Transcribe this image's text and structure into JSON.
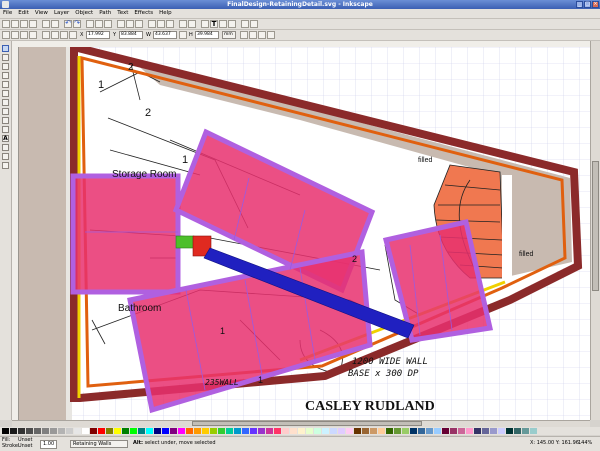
{
  "window": {
    "title": "FinalDesign-RetainingDetail.svg - Inkscape"
  },
  "menu": [
    "File",
    "Edit",
    "View",
    "Layer",
    "Object",
    "Path",
    "Text",
    "Effects",
    "Help"
  ],
  "toolbar2": {
    "x_label": "X",
    "x_value": "17.992",
    "y_label": "Y",
    "y_value": "83.884",
    "w_label": "W",
    "w_value": "43.637",
    "h_label": "H",
    "h_value": "39.984",
    "unit": "mm"
  },
  "drawing": {
    "labels": {
      "storage_room": "Storage Room",
      "bathroom": "Bathroom",
      "filled_1": "filled",
      "filled_2": "filled",
      "num_a": "1",
      "num_b": "2",
      "num_c": "1",
      "num_d": "2",
      "num_e": "1",
      "num_f": "2",
      "num_g": "1"
    },
    "handwriting_line1": "1200 WIDE WALL",
    "handwriting_line2": "BASE x 300 DP",
    "handwriting_side": "235WALL",
    "signature": "CASLEY RUDLAND"
  },
  "status": {
    "fill_label": "Fill:",
    "fill_value": "Unset",
    "stroke_label": "Stroke:",
    "stroke_value": "Unset",
    "opacity": "1.00",
    "layer": "Retaining Walls",
    "message_bold": "Alt:",
    "message": " select under, move selected",
    "coords": "X: 145.00  Y: 161.96",
    "zoom": "144%"
  },
  "colors": {
    "wall_maroon": "#8b2a2a",
    "orange_stripe": "#e0600f",
    "yellow_stripe": "#f0d000",
    "retaining_pink": "#e8306f",
    "retaining_purple": "#b060e0",
    "blue_beam": "#2020c0",
    "stair_orange": "#f07850",
    "floor_grey": "#c8bab0"
  }
}
